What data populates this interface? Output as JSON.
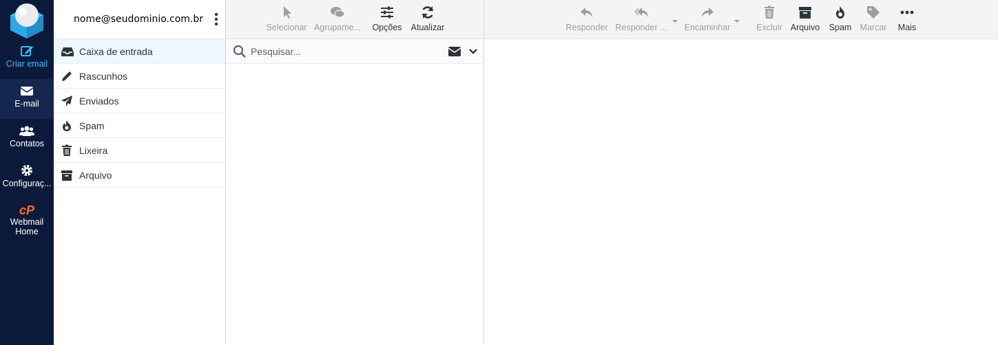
{
  "nav": {
    "compose": "Criar email",
    "mail": "E-mail",
    "contacts": "Contatos",
    "settings": "Configuraç...",
    "webmail_home": "Webmail Home",
    "cpanel_logo_text": "cP"
  },
  "account": {
    "username": "nome@seudominio.com.br"
  },
  "folders": [
    {
      "label": "Caixa de entrada",
      "icon": "inbox-icon"
    },
    {
      "label": "Rascunhos",
      "icon": "pencil-icon"
    },
    {
      "label": "Enviados",
      "icon": "paper-plane-icon"
    },
    {
      "label": "Spam",
      "icon": "fire-icon"
    },
    {
      "label": "Lixeira",
      "icon": "trash-icon"
    },
    {
      "label": "Arquivo",
      "icon": "archive-icon"
    }
  ],
  "list_toolbar": {
    "select": "Selecionar",
    "threads": "Agrupame...",
    "options": "Opções",
    "refresh": "Atualizar"
  },
  "search": {
    "placeholder": "Pesquisar..."
  },
  "message_toolbar": {
    "reply": "Responder",
    "reply_all": "Responder ...",
    "forward": "Encaminhar",
    "delete": "Excluir",
    "archive": "Arquivo",
    "spam": "Spam",
    "mark": "Marcar",
    "more": "Mais"
  },
  "colors": {
    "nav_bg": "#0b1a3a",
    "nav_active": "#15274f",
    "compose_accent": "#37beff",
    "cpanel_orange": "#ff6c2c",
    "selected_folder_bg": "#eef7fd",
    "toolbar_bg": "#f4f4f4",
    "disabled_text": "#9a9fa2"
  }
}
